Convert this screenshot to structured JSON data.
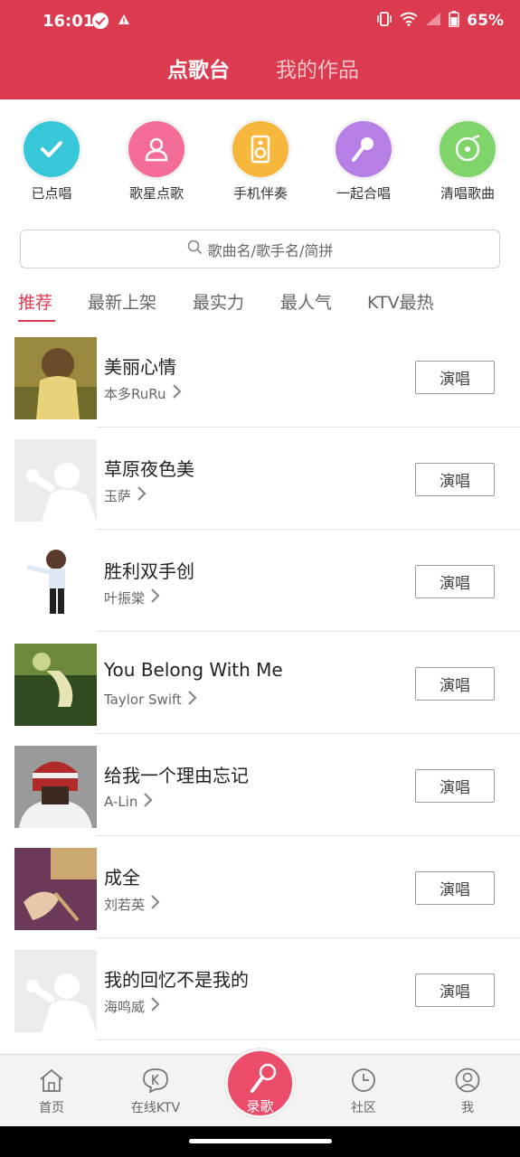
{
  "status_bar": {
    "time": "16:01",
    "battery": "65%"
  },
  "header": {
    "tab_active": "点歌台",
    "tab_inactive": "我的作品"
  },
  "categories": [
    {
      "label": "已点唱",
      "color": "#36c8d9",
      "icon": "check-icon"
    },
    {
      "label": "歌星点歌",
      "color": "#f36d96",
      "icon": "singer-icon"
    },
    {
      "label": "手机伴奏",
      "color": "#f6b73c",
      "icon": "speaker-icon"
    },
    {
      "label": "一起合唱",
      "color": "#b77ee6",
      "icon": "microphone-icon"
    },
    {
      "label": "清唱歌曲",
      "color": "#7fd46a",
      "icon": "record-disc-icon"
    }
  ],
  "search": {
    "placeholder": "歌曲名/歌手名/简拼"
  },
  "subtabs": [
    "推荐",
    "最新上架",
    "最实力",
    "最人气",
    "KTV最热"
  ],
  "songs": [
    {
      "title": "美丽心情",
      "artist": "本多RuRu",
      "button": "演唱"
    },
    {
      "title": "草原夜色美",
      "artist": "玉萨",
      "button": "演唱"
    },
    {
      "title": "胜利双手创",
      "artist": "叶振棠",
      "button": "演唱"
    },
    {
      "title": "You Belong With Me",
      "artist": "Taylor Swift",
      "button": "演唱"
    },
    {
      "title": "给我一个理由忘记",
      "artist": "A-Lin",
      "button": "演唱"
    },
    {
      "title": "成全",
      "artist": "刘若英",
      "button": "演唱"
    },
    {
      "title": "我的回忆不是我的",
      "artist": "海鸣威",
      "button": "演唱"
    }
  ],
  "bottom_nav": {
    "home": "首页",
    "ktv": "在线KTV",
    "record": "录歌",
    "community": "社区",
    "me": "我"
  },
  "colors": {
    "brand": "#dc3a4f",
    "record": "#ea4c6a"
  }
}
